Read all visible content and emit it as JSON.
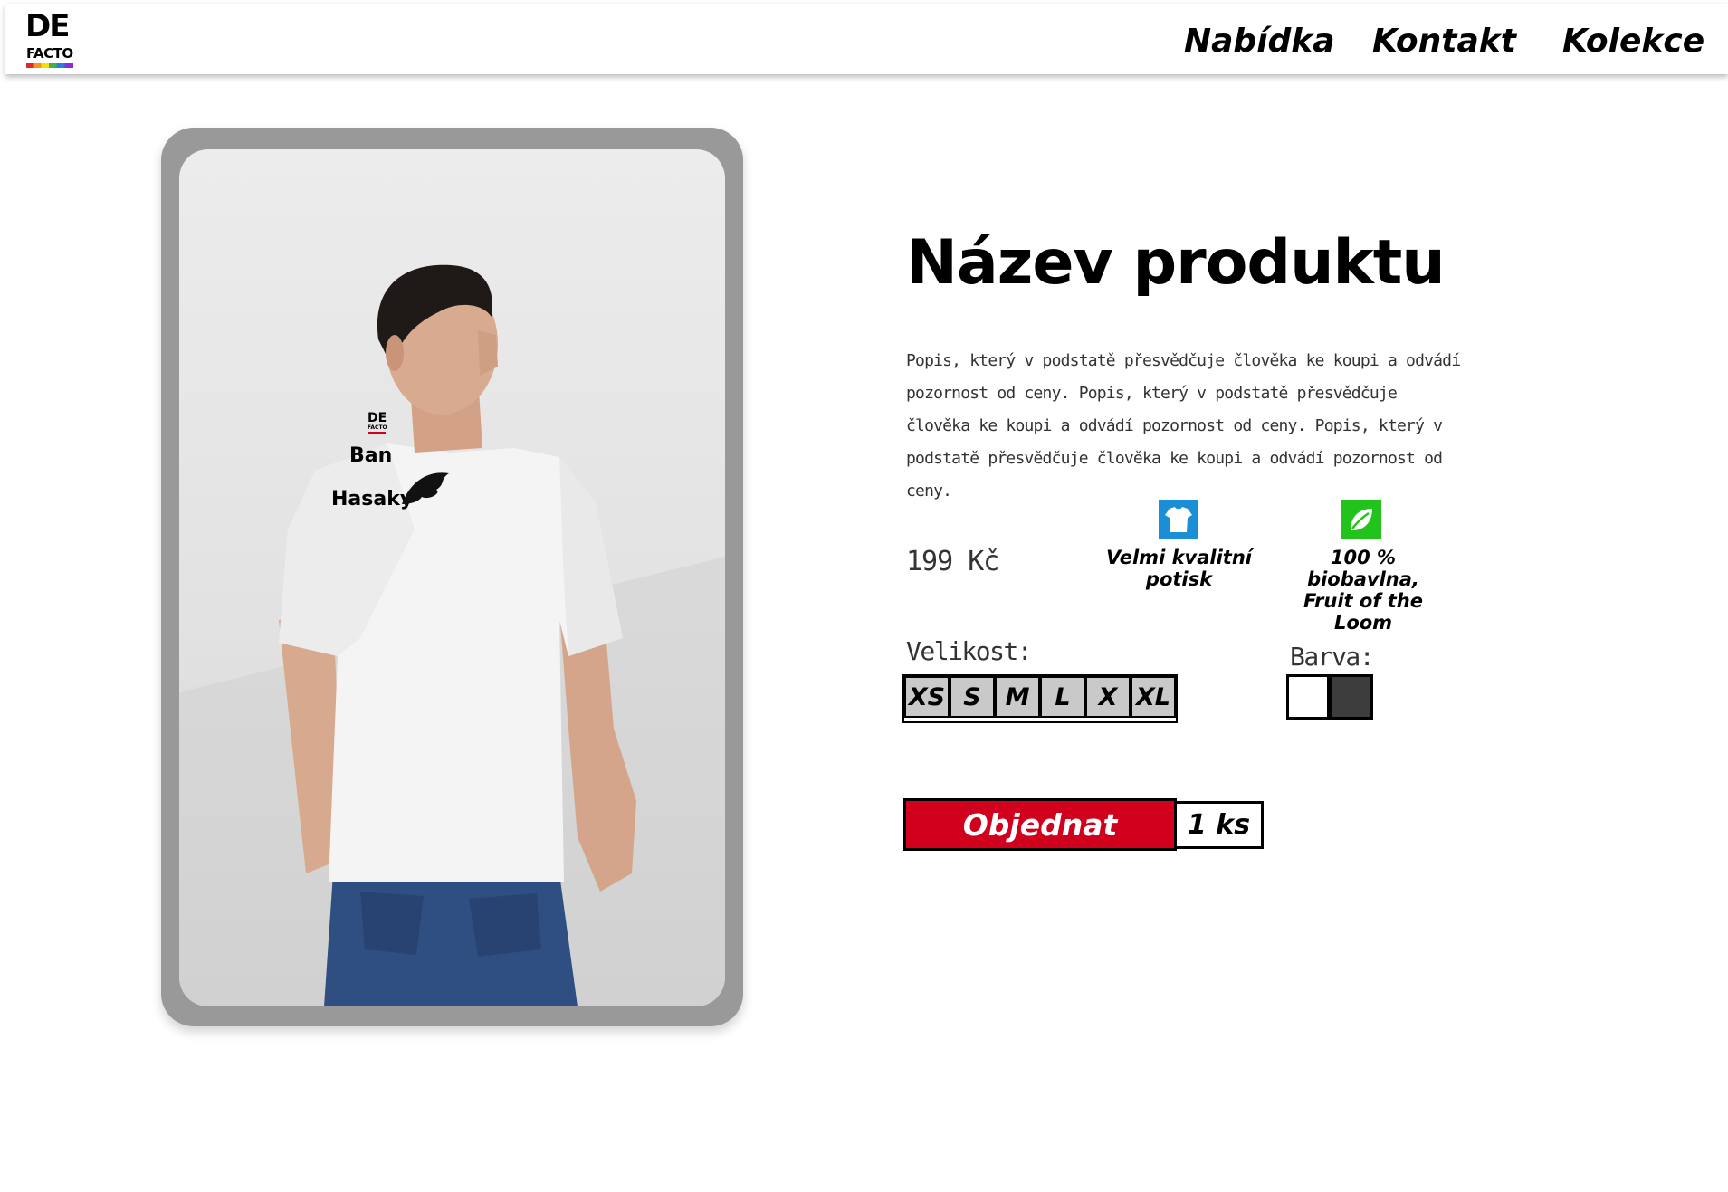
{
  "header": {
    "logo_top": "DE",
    "logo_bottom": "FACTO",
    "nav": [
      "Nabídka",
      "Kontakt",
      "Kolekce"
    ]
  },
  "product": {
    "photo_print": {
      "logo_top": "DE",
      "logo_bottom": "FACTO",
      "line1": "Ban",
      "line2": "Hasaky"
    },
    "title": "Název produktu",
    "description": "Popis, který v podstatě přesvědčuje člověka ke koupi a odvádí pozornost od ceny. Popis, který v podstatě přesvědčuje člověka ke koupi a odvádí pozornost od ceny. Popis, který v podstatě přesvědčuje člověka ke koupi a odvádí pozornost od ceny.",
    "price": "199 Kč",
    "features": [
      {
        "icon": "tshirt-icon",
        "color": "#1a8fd6",
        "text": "Velmi kvalitní\npotisk"
      },
      {
        "icon": "leaf-icon",
        "color": "#22c41c",
        "text": "100 % biobavlna,\nFruit of the Loom"
      }
    ],
    "size_label": "Velikost:",
    "sizes": [
      "XS",
      "S",
      "M",
      "L",
      "X",
      "XL"
    ],
    "color_label": "Barva:",
    "colors": [
      "#ffffff",
      "#3d3d3d"
    ],
    "order_label": "Objednat",
    "quantity": "1 ks"
  }
}
